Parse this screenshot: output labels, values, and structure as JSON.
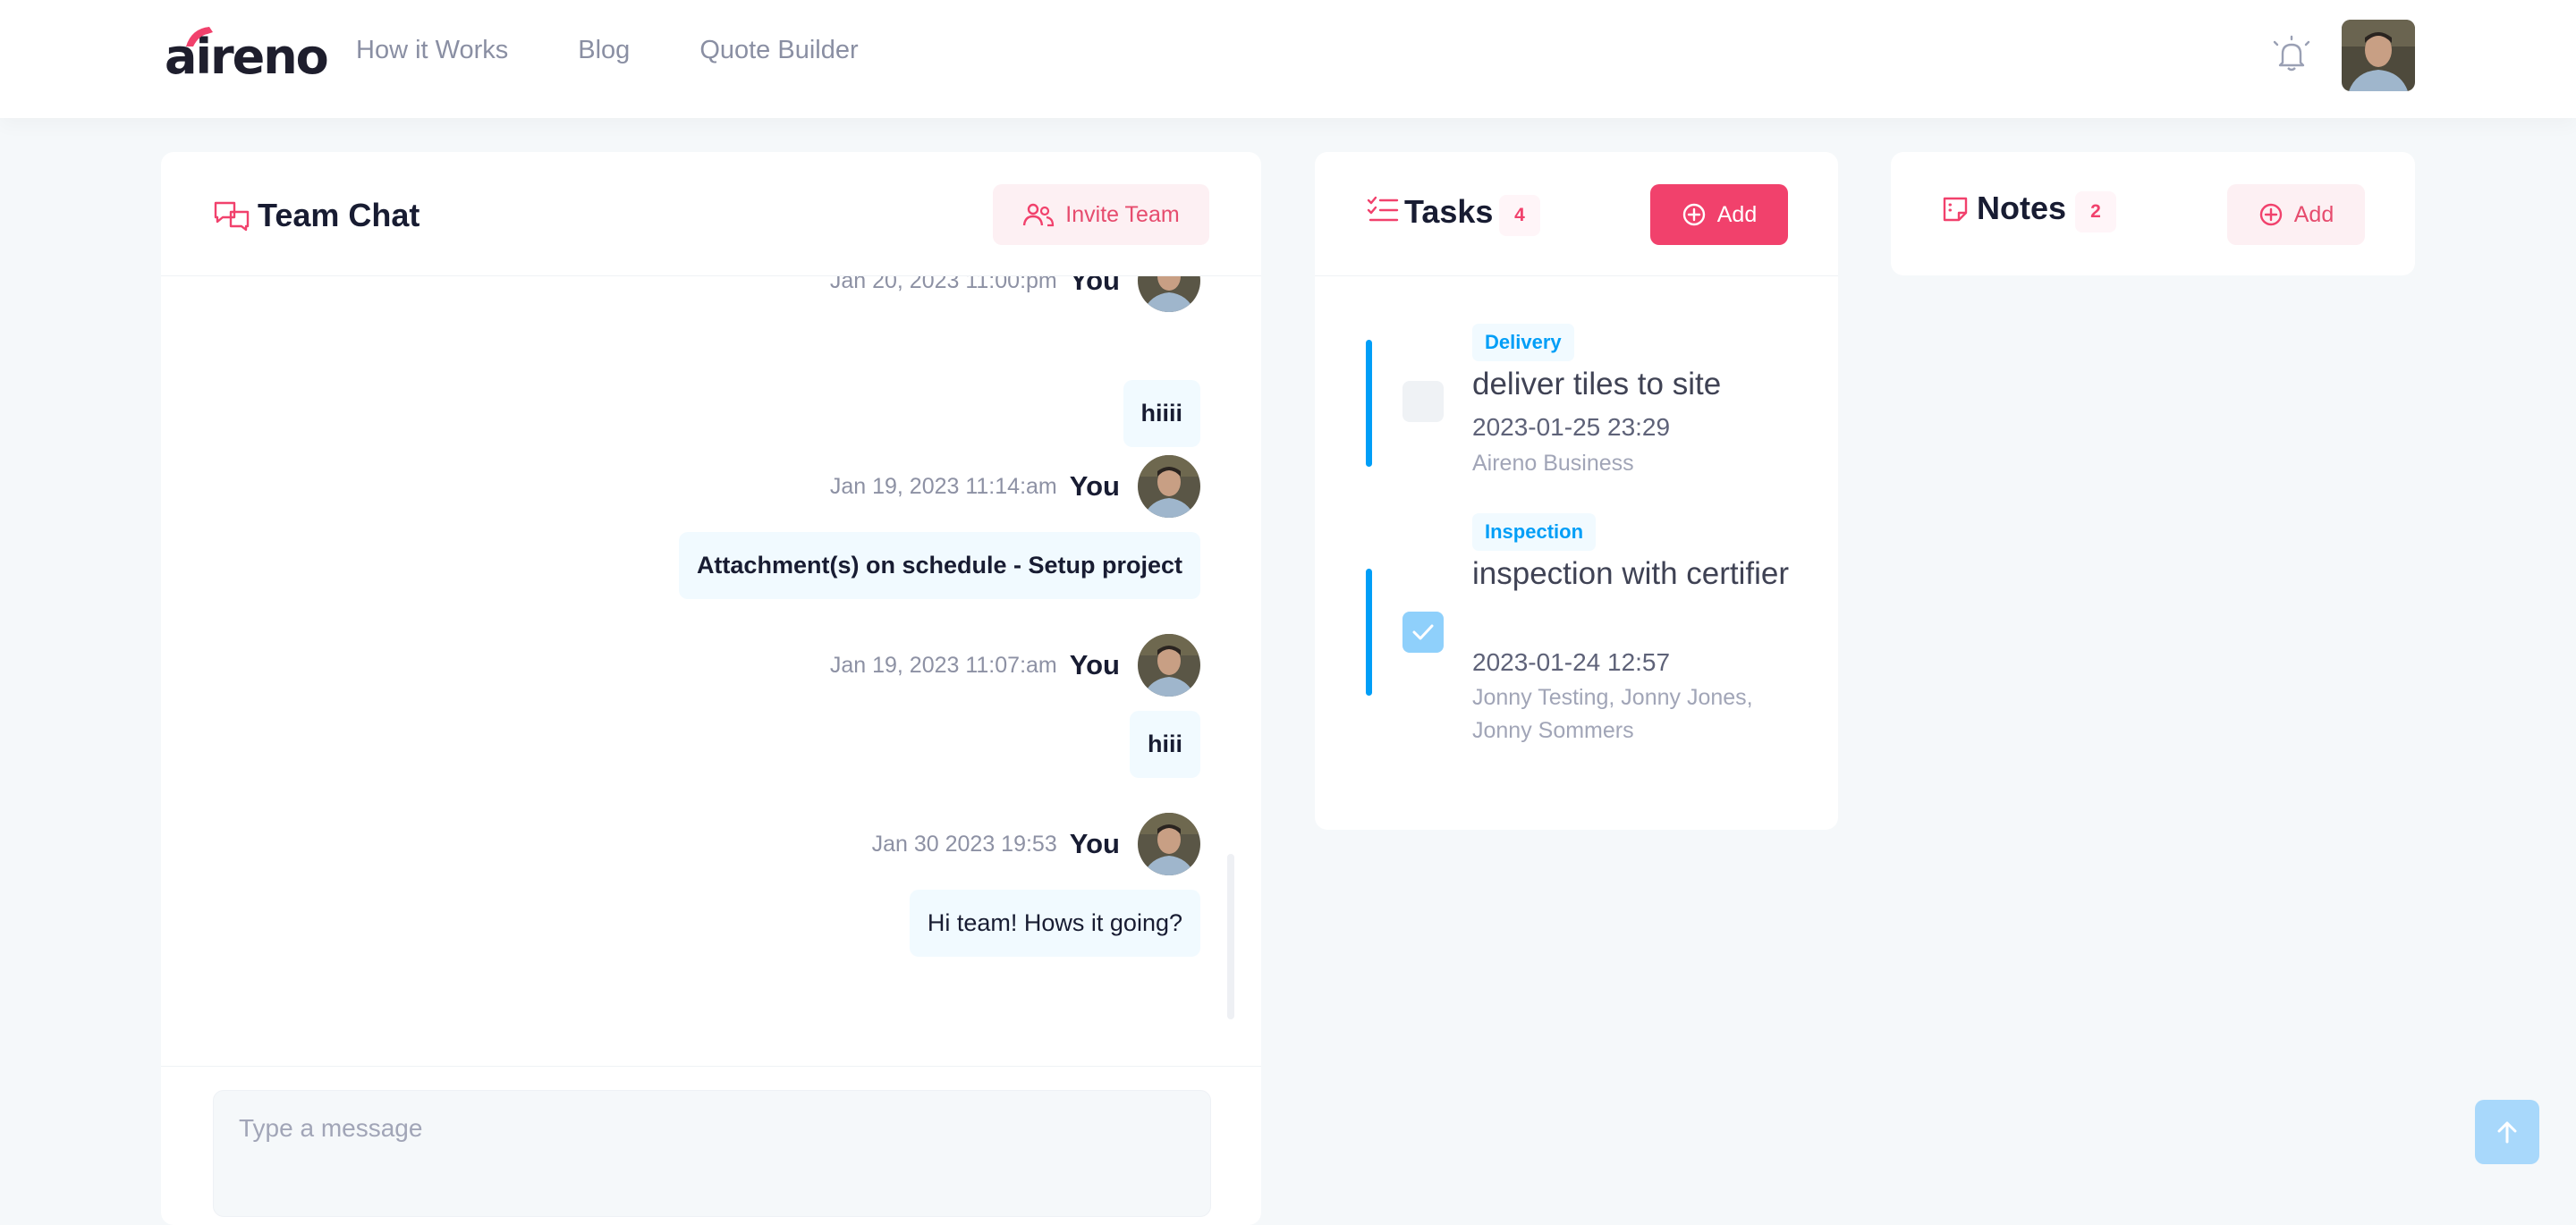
{
  "app": {
    "logo_text": "aireno"
  },
  "nav": {
    "items": [
      "How it Works",
      "Blog",
      "Quote Builder"
    ]
  },
  "chat": {
    "title": "Team Chat",
    "invite_label": "Invite Team",
    "composer_placeholder": "Type a message",
    "messages": [
      {
        "time": "Jan 20, 2023 11:00:pm",
        "sender": "You",
        "text": "hiiii",
        "bold": true
      },
      {
        "time": "Jan 19, 2023 11:14:am",
        "sender": "You",
        "text": "Attachment(s) on schedule - Setup project",
        "bold": true
      },
      {
        "time": "Jan 19, 2023 11:07:am",
        "sender": "You",
        "text": "hiii",
        "bold": true
      },
      {
        "time": "Jan 30 2023 19:53",
        "sender": "You",
        "text": "Hi team! Hows it going?",
        "bold": false
      }
    ]
  },
  "tasks": {
    "title": "Tasks",
    "count": "4",
    "add_label": "Add",
    "items": [
      {
        "tag": "Delivery",
        "title": "deliver tiles to site",
        "datetime": "2023-01-25 23:29",
        "assignees": "Aireno Business",
        "checked": false
      },
      {
        "tag": "Inspection",
        "title": "inspection with certifier",
        "datetime": "2023-01-24 12:57",
        "assignees": "Jonny Testing, Jonny Jones, Jonny Sommers",
        "checked": true
      }
    ]
  },
  "notes": {
    "title": "Notes",
    "count": "2",
    "add_label": "Add"
  },
  "colors": {
    "accent": "#f1416c",
    "info": "#009ef7",
    "background": "#f5f8fa"
  },
  "icons": [
    "bell-icon",
    "chat-icon",
    "invite-team-icon",
    "tasks-icon",
    "notes-icon",
    "add-circle-icon",
    "check-icon",
    "arrow-up-icon"
  ]
}
